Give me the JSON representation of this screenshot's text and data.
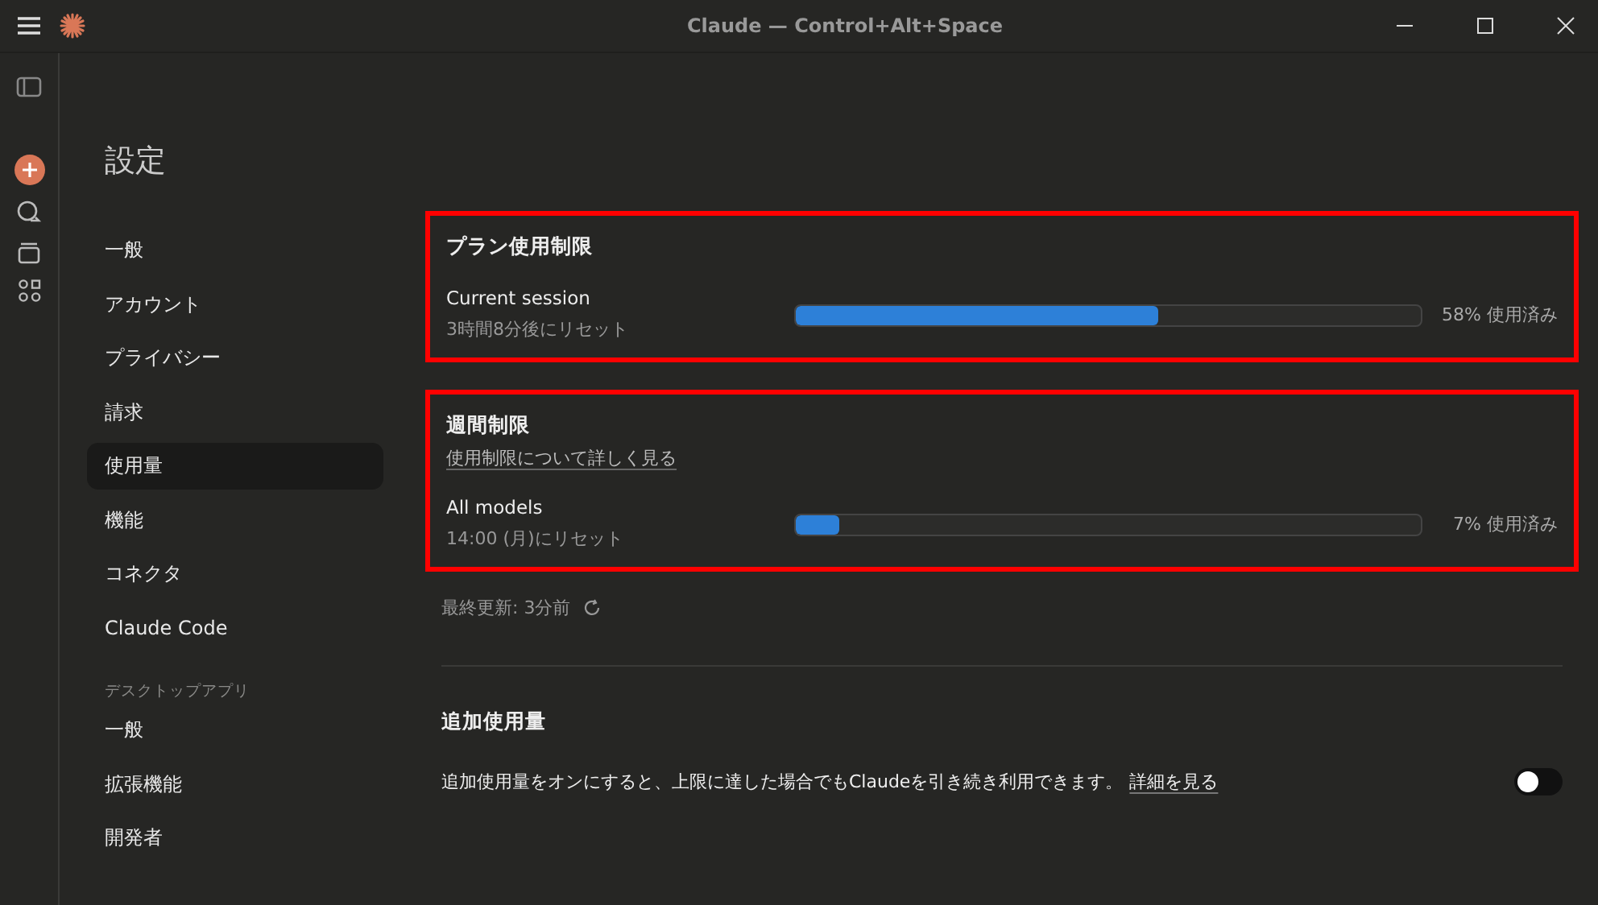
{
  "window": {
    "title": "Claude — Control+Alt+Space"
  },
  "settings": {
    "title": "設定",
    "nav": [
      {
        "label": "一般",
        "selected": false
      },
      {
        "label": "アカウント",
        "selected": false
      },
      {
        "label": "プライバシー",
        "selected": false
      },
      {
        "label": "請求",
        "selected": false
      },
      {
        "label": "使用量",
        "selected": true
      },
      {
        "label": "機能",
        "selected": false
      },
      {
        "label": "コネクタ",
        "selected": false
      },
      {
        "label": "Claude Code",
        "selected": false
      }
    ],
    "nav_group": {
      "heading": "デスクトップアプリ",
      "items": [
        {
          "label": "一般",
          "selected": false
        },
        {
          "label": "拡張機能",
          "selected": false
        },
        {
          "label": "開発者",
          "selected": false
        }
      ]
    }
  },
  "sections": [
    {
      "title": "プラン使用制限",
      "highlighted": true,
      "meters": [
        {
          "name": "Current session",
          "reset": "3時間8分後にリセット",
          "level": 0.58,
          "reading": "58% 使用済み"
        }
      ]
    },
    {
      "title": "週間制限",
      "highlighted": true,
      "link": "使用制限について詳しく見る",
      "meters": [
        {
          "name": "All models",
          "reset": "14:00 (月)にリセット",
          "level": 0.07,
          "reading": "7% 使用済み"
        }
      ]
    }
  ],
  "last_updated": "最終更新: 3分前",
  "extra_usage": {
    "title": "追加使用量",
    "description": "追加使用量をオンにすると、上限に達した場合でもClaudeを引き続き利用できます。",
    "link": "詳細を見る",
    "on": false
  }
}
